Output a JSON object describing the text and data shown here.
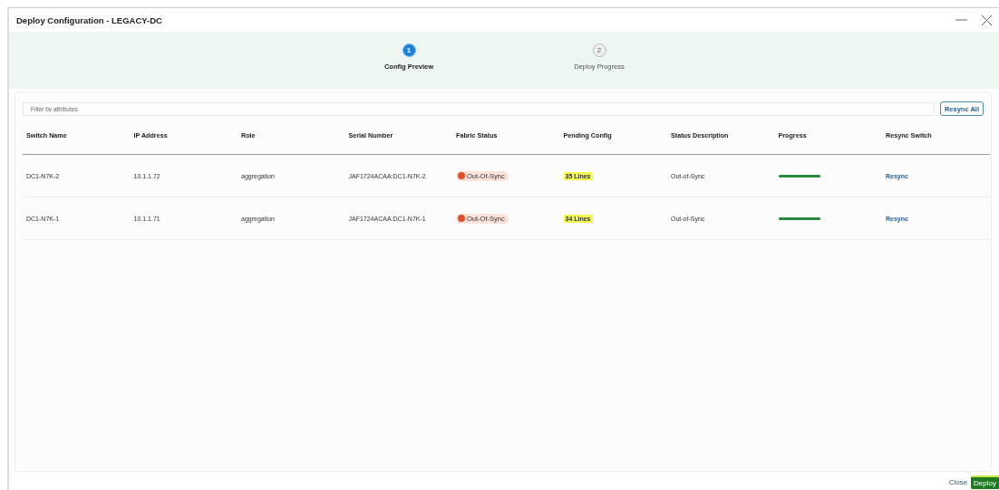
{
  "window": {
    "title": "Deploy Configuration - LEGACY-DC"
  },
  "steps": [
    {
      "number": "1",
      "label": "Config Preview",
      "selected": true
    },
    {
      "number": "2",
      "label": "Deploy Progress",
      "selected": false
    }
  ],
  "filter": {
    "placeholder": "Filter by attributes"
  },
  "resync_all": "Resync All",
  "table": {
    "columns": [
      "Switch Name",
      "IP Address",
      "Role",
      "Serial Number",
      "Fabric Status",
      "Pending Config",
      "Status Description",
      "Progress",
      "Resync Switch"
    ],
    "rows": [
      {
        "switch_name": "DC1-N7K-2",
        "ip": "10.1.1.72",
        "role": "aggregation",
        "serial": "JAF1724ACAA:DC1-N7K-2",
        "fabric_status": "Out-Of-Sync",
        "pending": "35 Lines",
        "highlighted": true,
        "description": "Out-of-Sync",
        "level": 1,
        "action": "Resync"
      },
      {
        "switch_name": "DC1-N7K-1",
        "ip": "10.1.1.71",
        "role": "aggregation",
        "serial": "JAF1724ACAA:DC1-N7K-1",
        "fabric_status": "Out-Of-Sync",
        "pending": "34 Lines",
        "highlighted": true,
        "description": "Out-of-Sync",
        "level": 1,
        "action": "Resync"
      }
    ]
  },
  "footer": {
    "close": "Close",
    "deploy": "Deploy"
  }
}
